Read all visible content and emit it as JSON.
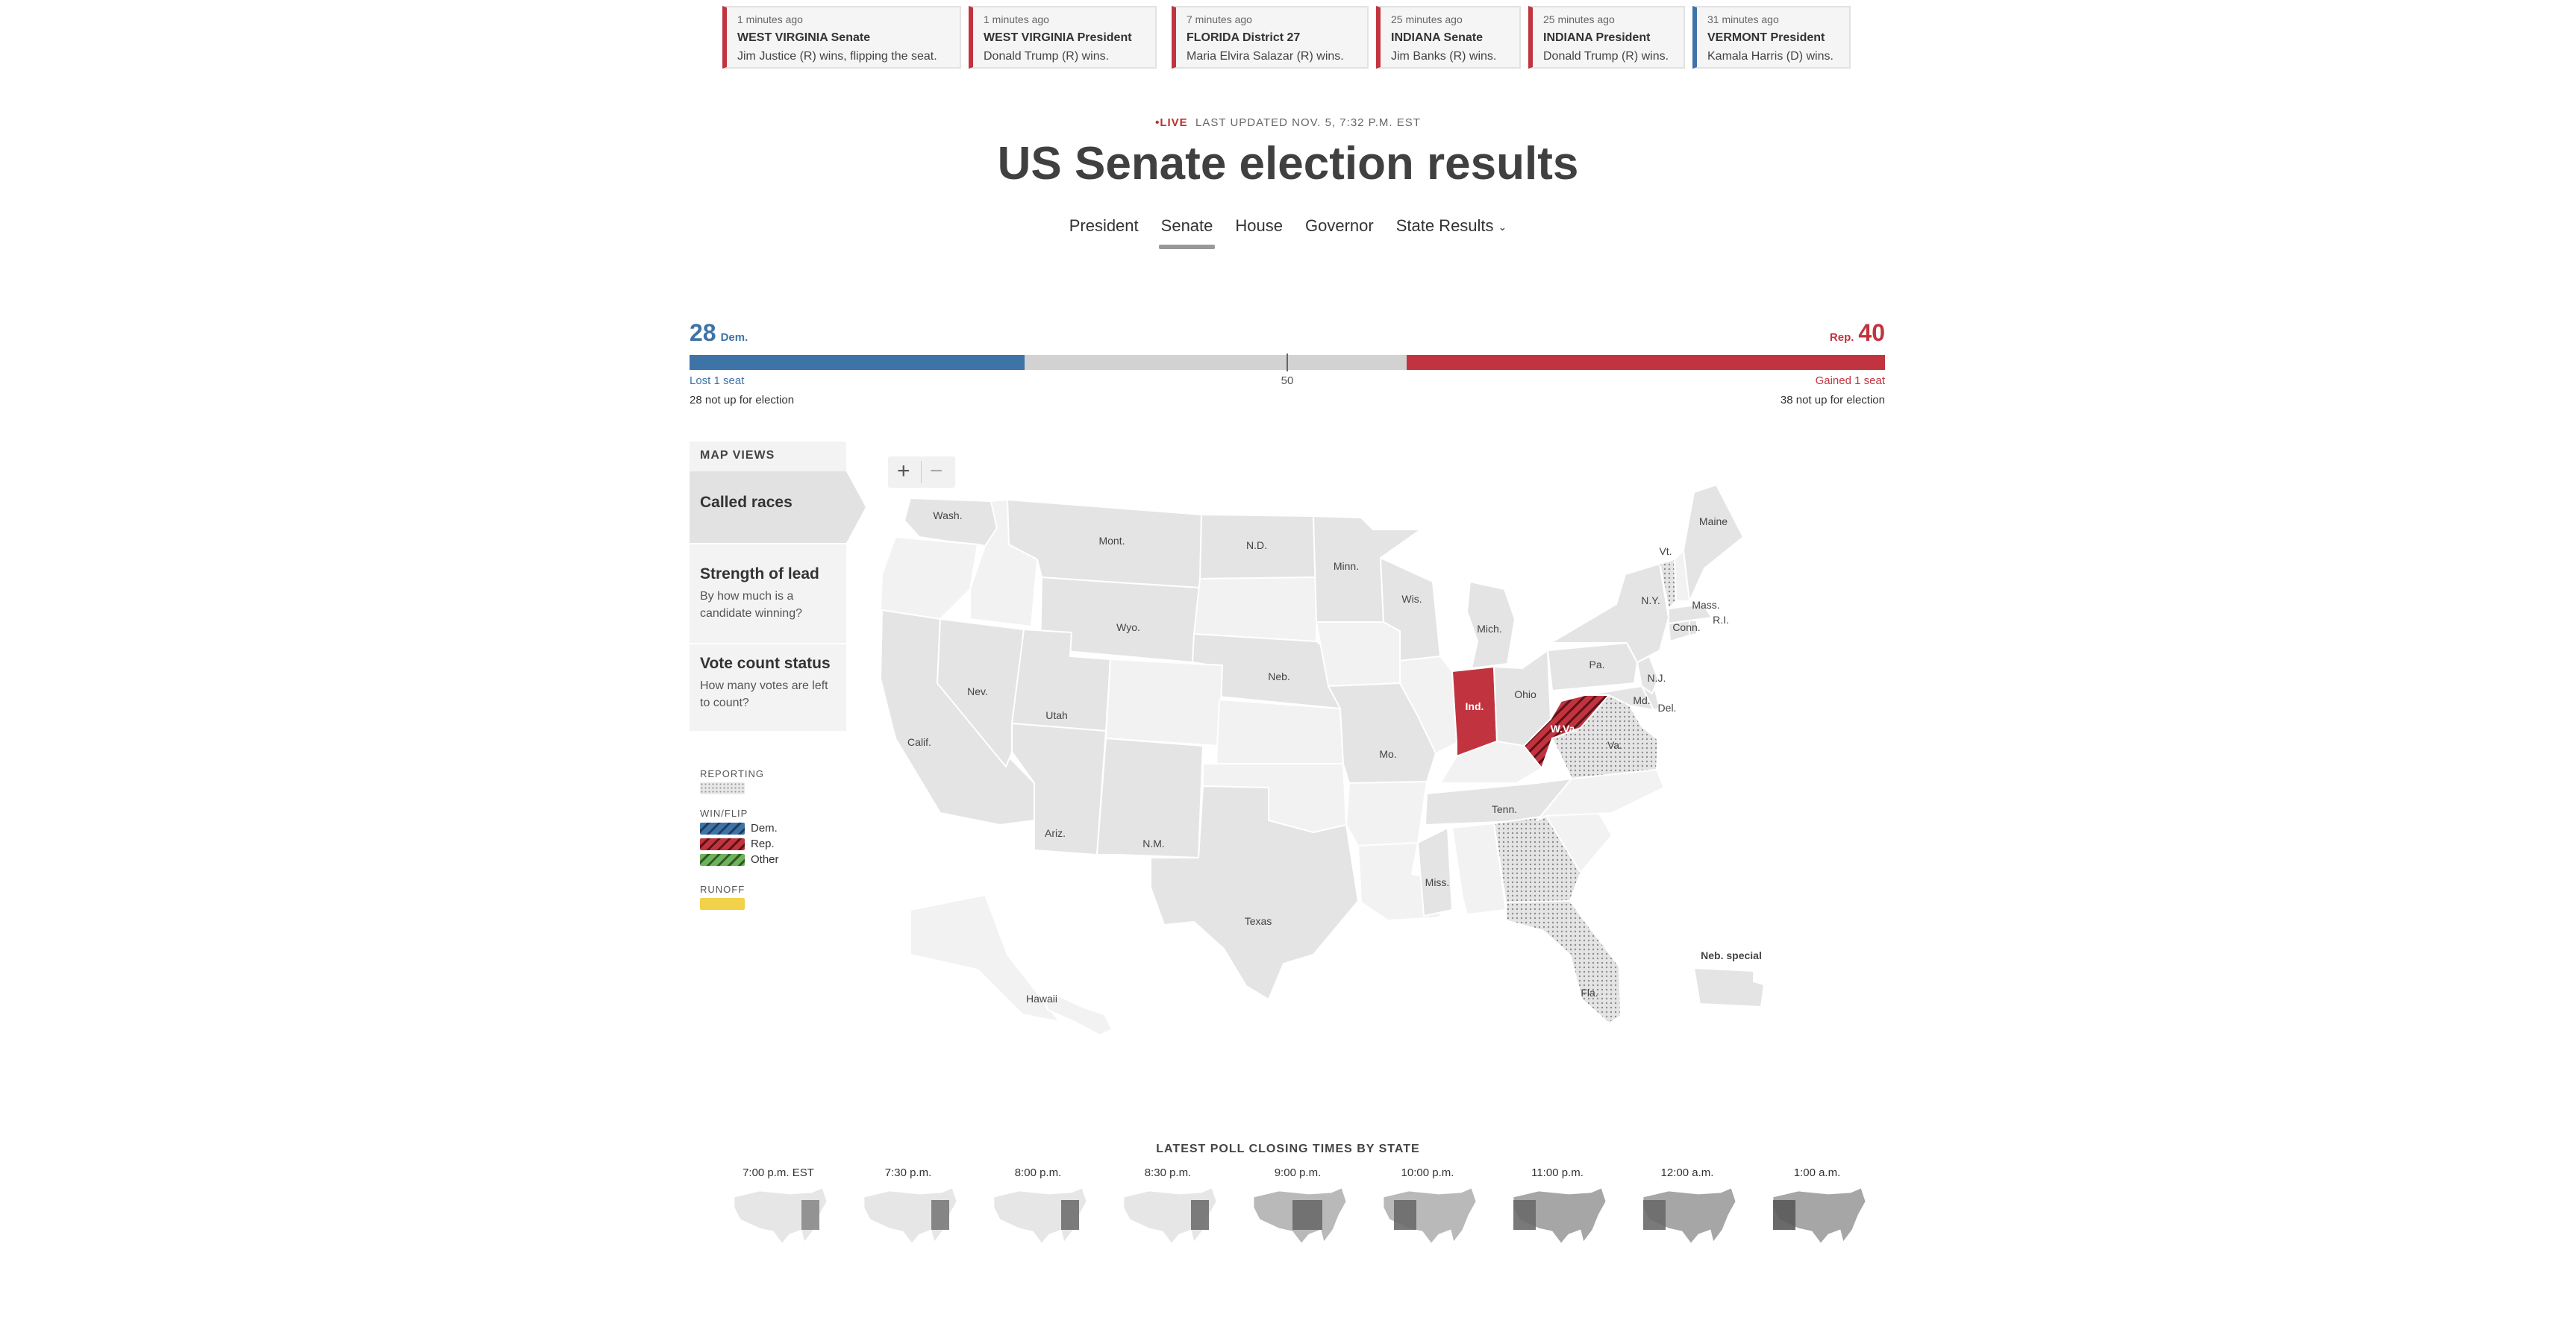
{
  "ticker": [
    {
      "time": "1 minutes ago",
      "title": "WEST VIRGINIA Senate",
      "desc": "Jim Justice (R) wins, flipping the seat.",
      "party": "R"
    },
    {
      "time": "1 minutes ago",
      "title": "WEST VIRGINIA President",
      "desc": "Donald Trump (R) wins.",
      "party": "R"
    },
    {
      "time": "7 minutes ago",
      "title": "FLORIDA District 27",
      "desc": "Maria Elvira Salazar (R) wins.",
      "party": "R"
    },
    {
      "time": "25 minutes ago",
      "title": "INDIANA Senate",
      "desc": "Jim Banks (R) wins.",
      "party": "R"
    },
    {
      "time": "25 minutes ago",
      "title": "INDIANA President",
      "desc": "Donald Trump (R) wins.",
      "party": "R"
    },
    {
      "time": "31 minutes ago",
      "title": "VERMONT President",
      "desc": "Kamala Harris (D) wins.",
      "party": "D"
    }
  ],
  "header": {
    "live": "LIVE",
    "updated": "LAST UPDATED NOV. 5, 7:32 P.M. EST",
    "title": "US Senate election results"
  },
  "nav": {
    "tabs": [
      "President",
      "Senate",
      "House",
      "Governor",
      "State Results"
    ],
    "active": "Senate"
  },
  "balance": {
    "dem_seats": 28,
    "dem_label": "Dem.",
    "rep_seats": 40,
    "rep_label": "Rep.",
    "majority_label": "50",
    "total_seats": 100,
    "dem_change": "Lost 1 seat",
    "rep_change": "Gained 1 seat",
    "dem_not_up": "28 not up for election",
    "rep_not_up": "38 not up for election"
  },
  "map_views": {
    "heading": "MAP VIEWS",
    "items": [
      {
        "title": "Called races",
        "desc": ""
      },
      {
        "title": "Strength of lead",
        "desc": "By how much is a candidate winning?"
      },
      {
        "title": "Vote count status",
        "desc": "How many votes are left to count?"
      }
    ]
  },
  "legend": {
    "reporting": "REPORTING",
    "winflip": "WIN/FLIP",
    "dem": "Dem.",
    "rep": "Rep.",
    "other": "Other",
    "runoff": "RUNOFF"
  },
  "zoom": {
    "in": "+",
    "out": "−"
  },
  "colors": {
    "dem": "#3e73a8",
    "rep": "#c1343f",
    "neutral": "#d2d2d2",
    "map_race": "#e4e4e4",
    "map_norace": "#f2f2f2",
    "runoff": "#f2d14b",
    "other": "#6db35c"
  },
  "map": {
    "labels": {
      "wa": "Wash.",
      "mt": "Mont.",
      "nd": "N.D.",
      "mn": "Minn.",
      "wi": "Wis.",
      "mi": "Mich.",
      "me": "Maine",
      "vt": "Vt.",
      "ny": "N.Y.",
      "ma": "Mass.",
      "ri": "R.I.",
      "ct": "Conn.",
      "pa": "Pa.",
      "nj": "N.J.",
      "oh": "Ohio",
      "md": "Md.",
      "de": "Del.",
      "va": "Va.",
      "wy": "Wyo.",
      "ne": "Neb.",
      "nv": "Nev.",
      "ut": "Utah",
      "ca": "Calif.",
      "in": "Ind.",
      "wv": "W.Va.",
      "mo": "Mo.",
      "tn": "Tenn.",
      "az": "Ariz.",
      "nm": "N.M.",
      "ms": "Miss.",
      "tx": "Texas",
      "fl": "Fla.",
      "hi": "Hawaii",
      "neb_special": "Neb. special"
    },
    "called": {
      "in": "R",
      "wv": "R-flip"
    },
    "reporting": [
      "va",
      "fl",
      "vt",
      "ga"
    ]
  },
  "poll_closing": {
    "heading": "LATEST POLL CLOSING TIMES BY STATE",
    "times": [
      "7:00 p.m. EST",
      "7:30 p.m.",
      "8:00 p.m.",
      "8:30 p.m.",
      "9:00 p.m.",
      "10:00 p.m.",
      "11:00 p.m.",
      "12:00 a.m.",
      "1:00 a.m."
    ]
  }
}
